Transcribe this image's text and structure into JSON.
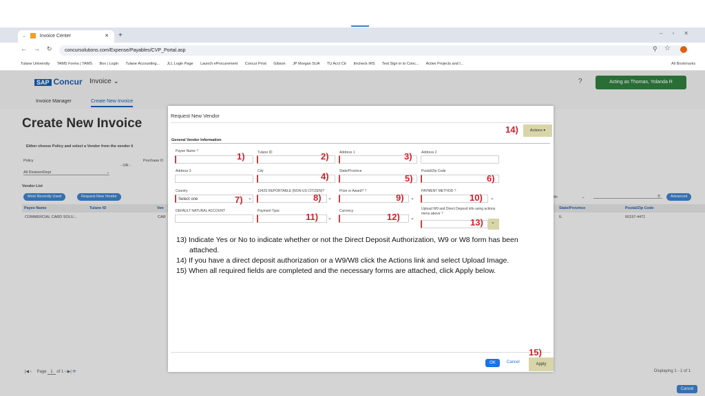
{
  "browser": {
    "tab_title": "Invoice Center",
    "url": "concursolutions.com/Expense/Payables/CVP_Portal.asp",
    "bookmarks": [
      "Tulane University",
      "TAMS Forms | TAMS",
      "Box | Login",
      "Tulane Accounting...",
      "JLL Login Page",
      "Launch eProcurement",
      "Concur Prod",
      "Gibson",
      "JP Morgan SUA",
      "TU Acct Ctr",
      "tincheck IRS",
      "Test Sign in to Conc...",
      "Active Projects and I..."
    ],
    "all_bookmarks": "All Bookmarks"
  },
  "app": {
    "logo_sap": "SAP",
    "logo_concur": "Concur",
    "module": "Invoice",
    "nav": [
      "Invoice Manager",
      "Create New Invoice"
    ],
    "acting_as": "Acting as Thomas, Yolanda R",
    "page_title": "Create New Invoice",
    "info": "Either choose Policy and select a Vendor from the vendor li",
    "policy_label": "Policy",
    "purchase_label": "Purchase O",
    "or_label": "- OR -",
    "policy_value": "All Division/Dept",
    "vendor_list": "Vendor List",
    "most_recent_btn": "Most Recently Used",
    "request_vendor_btn": "Request New Vendor",
    "col_payee": "Payee Name",
    "col_tulane": "Tulane ID",
    "col_ven": "Ven",
    "row_payee": "COMMERCIAL CARD SOLU...",
    "row_ven": "CAR",
    "with_label": "ith",
    "advanced_btn": "Advanced",
    "col_state": "State/Province",
    "col_postal": "Postal/Zip Code",
    "row_state": "IL",
    "row_postal": "60197-4471",
    "page_label": "Page",
    "page_num": "1",
    "of_label": "of 1",
    "displaying": "Displaying 1 - 1 of 1",
    "cancel_btn": "Cancel"
  },
  "modal": {
    "title": "Request New Vendor",
    "actions": "Actions",
    "section": "General Vendor Information",
    "fields": {
      "payee_name": "Payee Name",
      "tulane_id": "Tulane ID",
      "address1": "Address 1",
      "address2": "Address 2",
      "address3": "Address 3",
      "city": "City",
      "state": "State/Province",
      "postal": "Postal/Zip Code",
      "country": "Country",
      "country_value": "Select one",
      "reportable": "1042S REPORTABLE (NON-US CITIZEN)?",
      "prize": "Prize or Award?",
      "payment_method": "PAYMENT METHOD",
      "default_account": "DEFAULT NATURAL ACCOUNT",
      "payment_type": "Payment Type",
      "currency": "Currency",
      "upload_w9": "Upload W9 and Direct Deposit info using actions menu above"
    },
    "numbers": [
      "1)",
      "2)",
      "3)",
      "4)",
      "5)",
      "6)",
      "7)",
      "8)",
      "9)",
      "10)",
      "11)",
      "12)",
      "13)",
      "14)",
      "15)"
    ],
    "notes": [
      "13) Indicate Yes or No to indicate whether or not the Direct Deposit Authorization, W9 or W8 form has been attached.",
      "14) If you have a direct deposit authorization or a W9/W8 click the Actions link and select Upload Image.",
      "15) When all required fields are completed and the necessary forms are attached, click Apply below."
    ],
    "ok": "OK",
    "cancel": "Cancel",
    "apply": "Apply"
  }
}
